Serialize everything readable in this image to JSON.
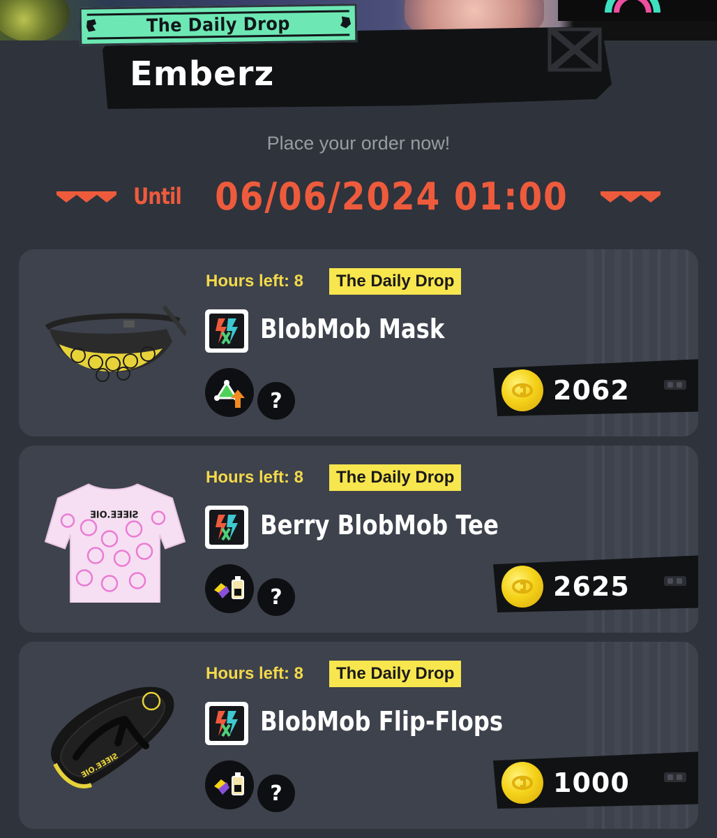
{
  "header": {
    "shop_tag": "The Daily Drop",
    "brand_name": "Emberz"
  },
  "order": {
    "prompt": "Place your order now!",
    "until_label": "Until",
    "deadline": "06/06/2024 01:00"
  },
  "items": [
    {
      "hours_left": "Hours left: 8",
      "badge": "The Daily Drop",
      "name": "BlobMob Mask",
      "main_ability_icon": "ink-saver-up-icon",
      "sub_ability_label": "?",
      "price": "2062",
      "image": "blobmob-mask-image"
    },
    {
      "hours_left": "Hours left: 8",
      "badge": "The Daily Drop",
      "name": "Berry BlobMob Tee",
      "main_ability_icon": "ink-resistance-icon",
      "sub_ability_label": "?",
      "price": "2625",
      "image": "berry-blobmob-tee-image"
    },
    {
      "hours_left": "Hours left: 8",
      "badge": "The Daily Drop",
      "name": "BlobMob Flip-Flops",
      "main_ability_icon": "ink-resistance-icon",
      "sub_ability_label": "?",
      "price": "1000",
      "image": "blobmob-flip-flops-image"
    }
  ],
  "colors": {
    "background": "#2f333c",
    "card": "#3d424c",
    "accent_red": "#ee5b3c",
    "hours_yellow": "#f4d94a",
    "badge_yellow": "#f8e64e",
    "tag_green": "#6de8b4"
  }
}
